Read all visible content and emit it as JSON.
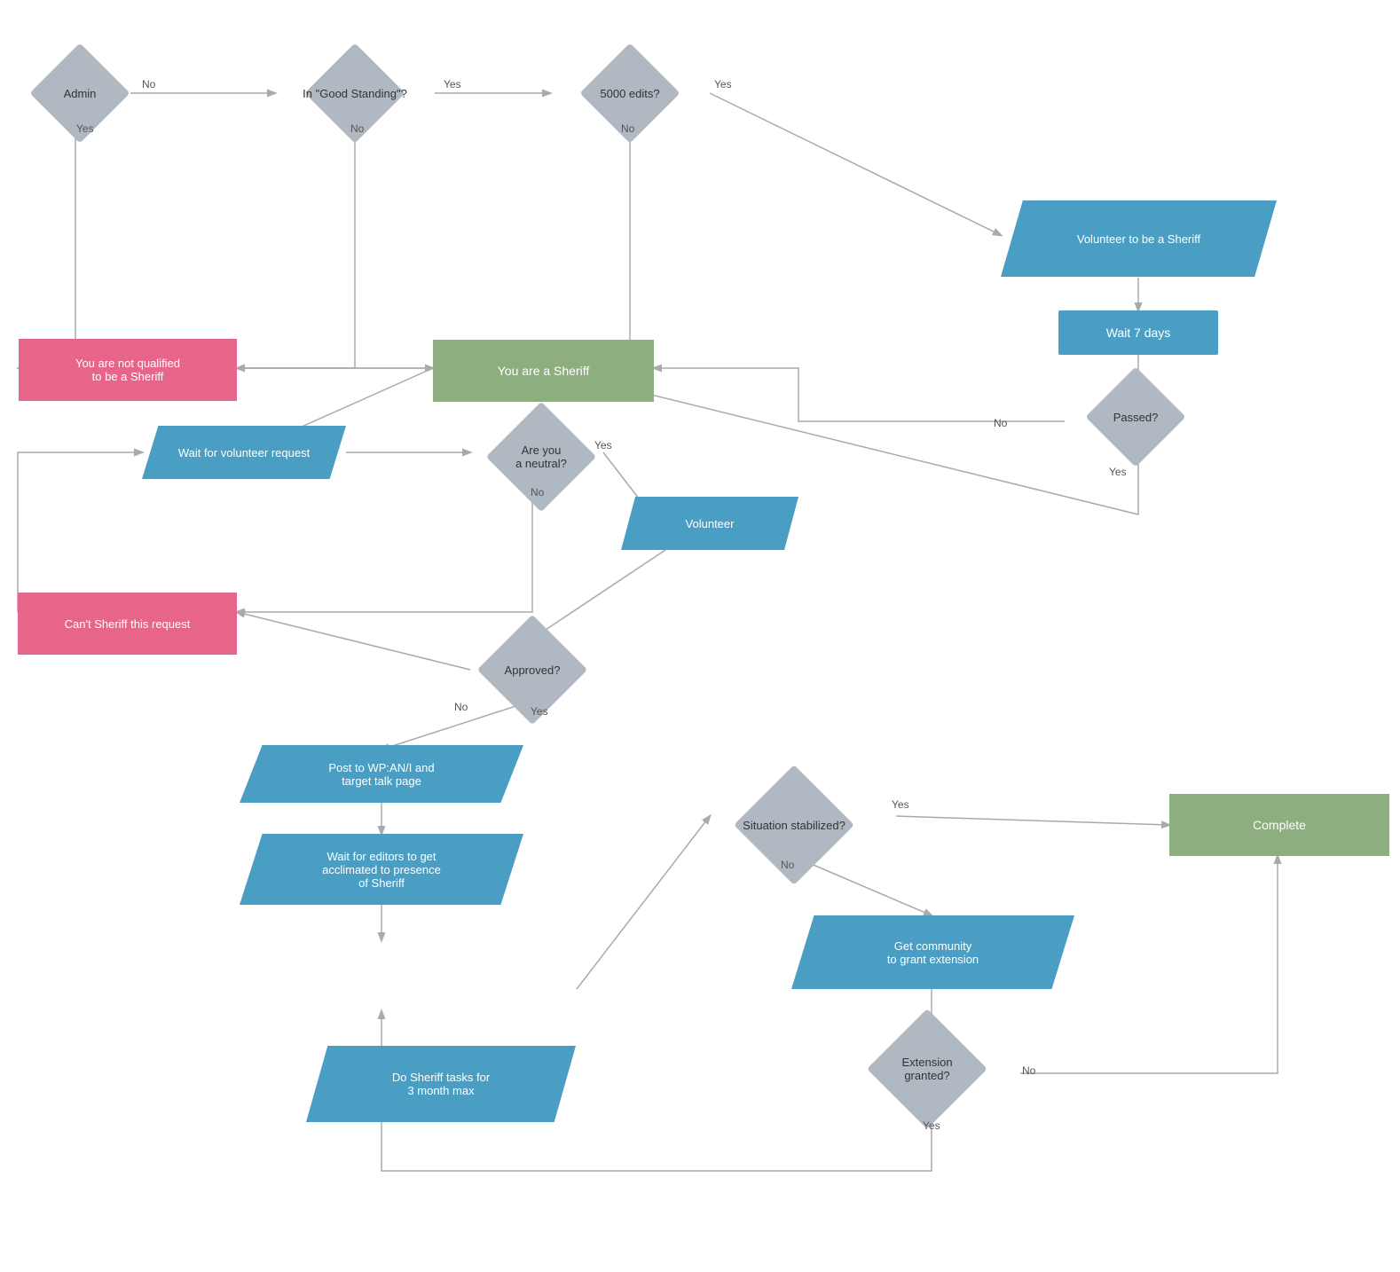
{
  "nodes": {
    "admin": {
      "label": "Admin"
    },
    "goodStanding": {
      "label": "In \"Good Standing\"?"
    },
    "edits5000": {
      "label": "5000 edits?"
    },
    "volunteer": {
      "label": "Volunteer to be a Sheriff"
    },
    "wait7days": {
      "label": "Wait 7 days"
    },
    "passed": {
      "label": "Passed?"
    },
    "notQualified": {
      "label": "You are not qualified\nto be a Sheriff"
    },
    "youAreSheriff": {
      "label": "You are a Sheriff"
    },
    "waitVolunteer": {
      "label": "Wait for volunteer request"
    },
    "areYouNeutral": {
      "label": "Are you\na neutral?"
    },
    "volunteerAction": {
      "label": "Volunteer"
    },
    "cantSheriff": {
      "label": "Can't Sheriff this request"
    },
    "approved": {
      "label": "Approved?"
    },
    "postWPAN": {
      "label": "Post to WP:AN/I and\ntarget talk page"
    },
    "waitEditors": {
      "label": "Wait for editors to get\nacclimated to presence\nof Sheriff"
    },
    "doSheriff": {
      "label": "Do Sheriff tasks for\n3 month max"
    },
    "situationStabilized": {
      "label": "Situation stabilized?"
    },
    "complete": {
      "label": "Complete"
    },
    "getCommunity": {
      "label": "Get community\nto grant extension"
    },
    "extensionGranted": {
      "label": "Extension\ngranted?"
    }
  },
  "labels": {
    "yes": "Yes",
    "no": "No"
  }
}
